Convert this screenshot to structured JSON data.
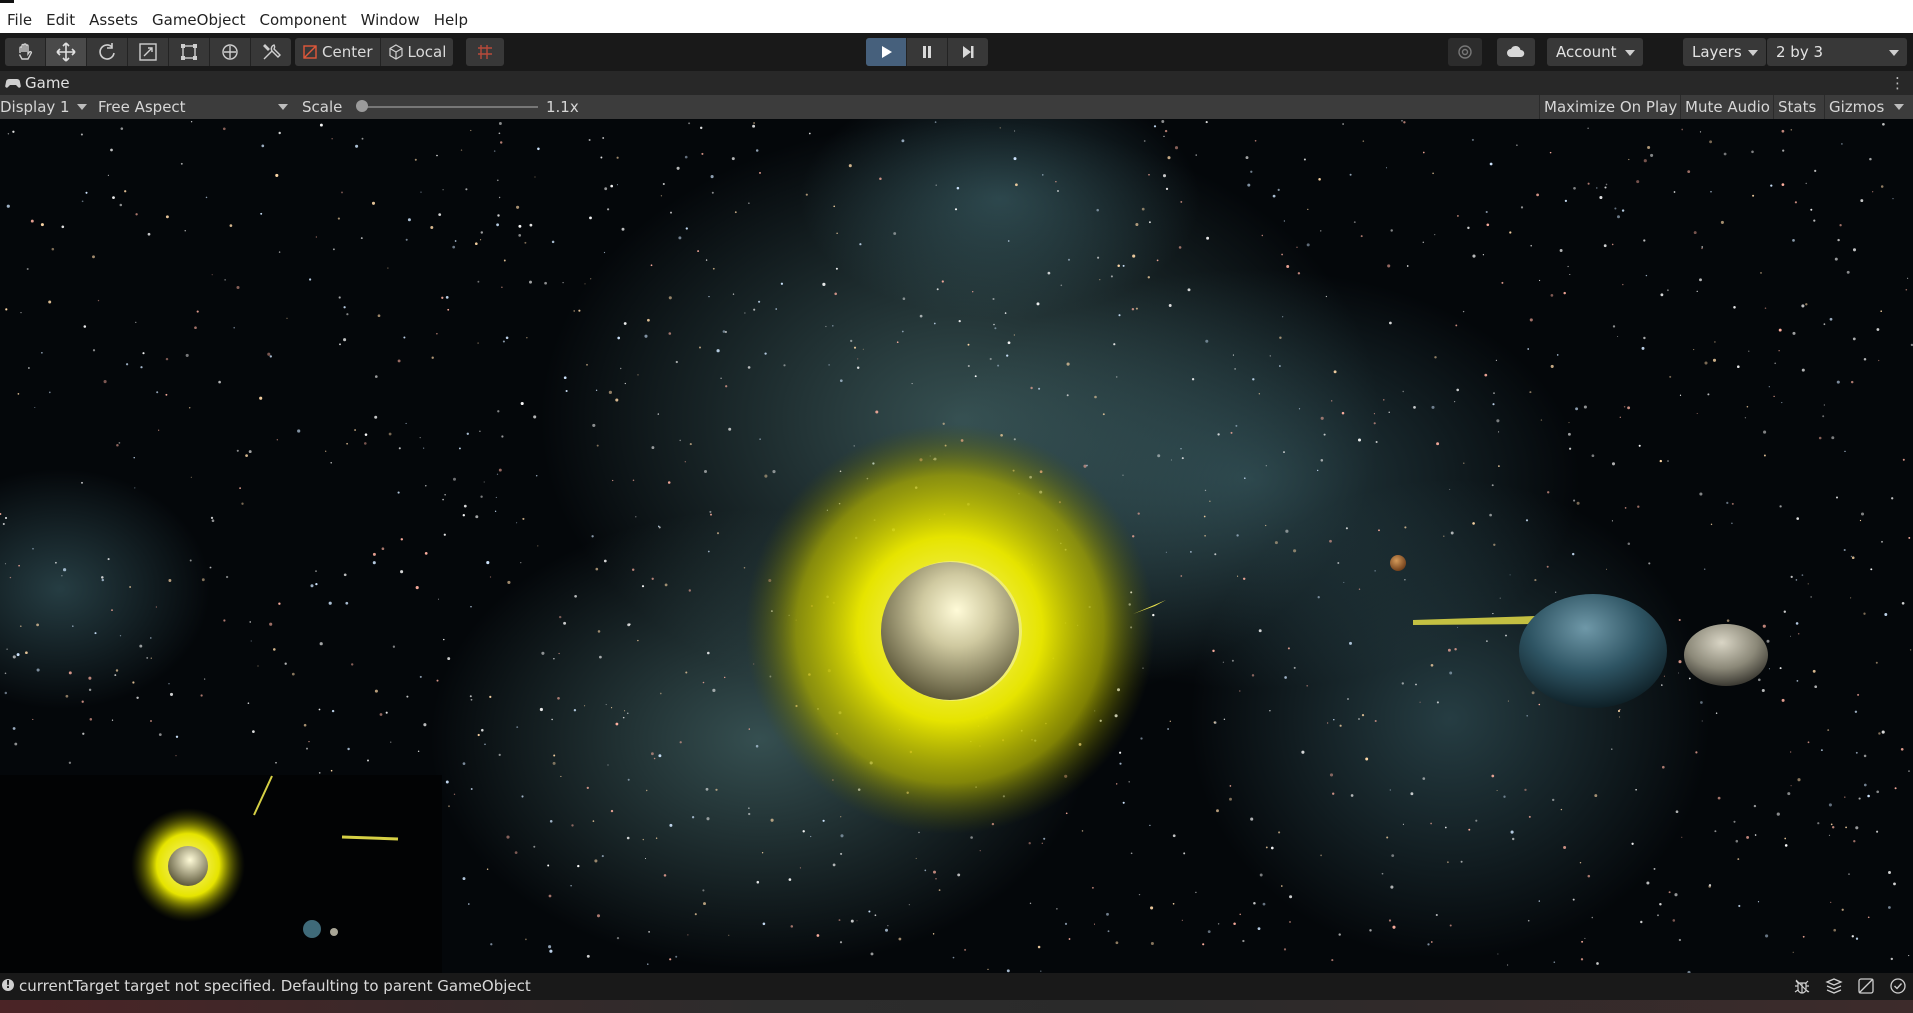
{
  "menu": {
    "items": [
      "File",
      "Edit",
      "Assets",
      "GameObject",
      "Component",
      "Window",
      "Help"
    ]
  },
  "toolbar": {
    "tools": [
      "hand-tool-icon",
      "move-tool-icon",
      "rotate-tool-icon",
      "scale-tool-icon",
      "rect-tool-icon",
      "transform-tool-icon",
      "custom-tool-icon"
    ],
    "pivot_mode": "Center",
    "pivot_rotation": "Local",
    "account_label": "Account",
    "layers_label": "Layers",
    "layout_label": "2 by 3",
    "play_state": "playing"
  },
  "game_view": {
    "tab_title": "Game",
    "display": "Display 1",
    "aspect": "Free Aspect",
    "scale_label": "Scale",
    "scale_value": "1.1x",
    "buttons": {
      "maximize": "Maximize On Play",
      "mute": "Mute Audio",
      "stats": "Stats",
      "gizmos": "Gizmos"
    }
  },
  "status": {
    "message": "currentTarget target not specified. Defaulting to parent GameObject"
  },
  "colors": {
    "accent_play": "#46607c",
    "sun_glow": "#e6e400",
    "nebula": "#5e8a8a"
  }
}
